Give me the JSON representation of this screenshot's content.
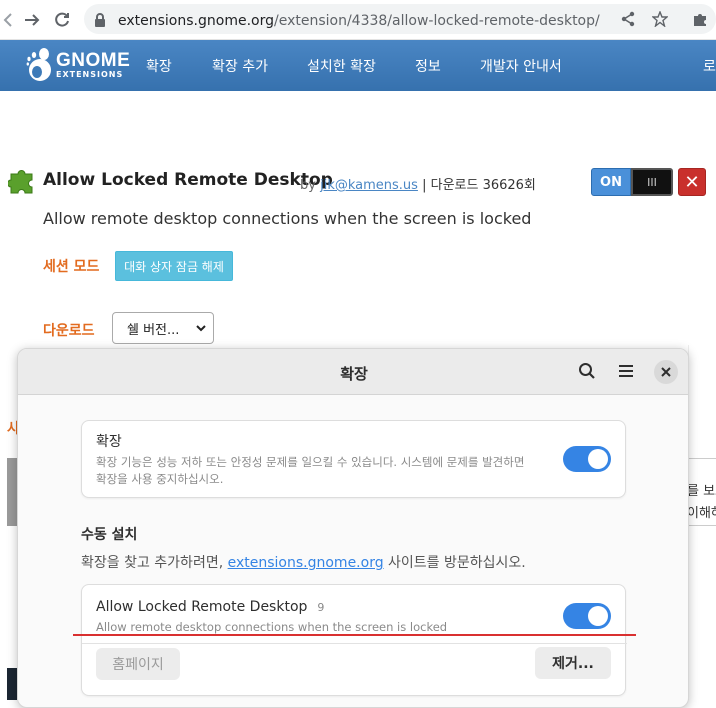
{
  "browser": {
    "url_host": "extensions.gnome.org",
    "url_path": "/extension/4338/allow-locked-remote-desktop/"
  },
  "header": {
    "logo_text": "GNOME",
    "logo_sub": "EXTENSIONS",
    "nav": [
      "확장",
      "확장 추가",
      "설치한 확장",
      "정보",
      "개발자 안내서",
      "로"
    ]
  },
  "extension": {
    "title": "Allow Locked Remote Desktop",
    "by": "by",
    "author": "jik@kamens.us",
    "sep": "|",
    "downloads": "다운로드 36626회",
    "switch_on": "ON",
    "switch_handle": "III",
    "remove_glyph": "✕",
    "description": "Allow remote desktop connections when the screen is locked",
    "session_label": "세션 모드",
    "session_badge": "대화 상자 잠금 해제",
    "download_label": "다운로드",
    "shell_select": "쉘 버전..."
  },
  "background": {
    "left_letter": "사",
    "right_text_1": "를 보고",
    "right_text_2": "이해하"
  },
  "dialog": {
    "title": "확장",
    "extensions_card": {
      "title": "확장",
      "desc_line1": "확장 기능은 성능 저하 또는 안정성 문제를 일으킬 수 있습니다. 시스템에 문제를 발견하면",
      "desc_line2": "확장을 사용 중지하십시오.",
      "enabled": true
    },
    "manual_section": {
      "title": "수동 설치",
      "desc_before": "확장을 찾고 추가하려면, ",
      "desc_link": "extensions.gnome.org",
      "desc_after": " 사이트를 방문하십시오."
    },
    "installed_ext": {
      "name": "Allow Locked Remote Desktop",
      "version": "9",
      "description": "Allow remote desktop connections when the screen is locked",
      "enabled": true,
      "homepage_button": "홈페이지",
      "remove_button": "제거..."
    }
  },
  "colors": {
    "gnome_blue": "#3d7ab8",
    "toggle_blue": "#3584e4",
    "accent_orange": "#e26b1f",
    "remove_red": "#c9302c",
    "highlight_line": "#d93030"
  }
}
